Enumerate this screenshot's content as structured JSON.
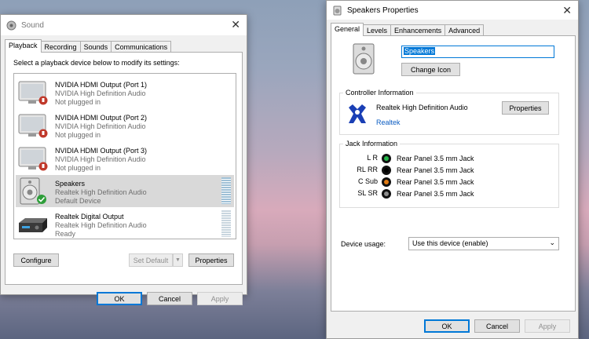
{
  "sound_window": {
    "title": "Sound",
    "tabs": [
      "Playback",
      "Recording",
      "Sounds",
      "Communications"
    ],
    "instruction": "Select a playback device below to modify its settings:",
    "devices": [
      {
        "name": "NVIDIA HDMI Output (Port 1)",
        "driver": "NVIDIA High Definition Audio",
        "status": "Not plugged in"
      },
      {
        "name": "NVIDIA HDMI Output (Port 2)",
        "driver": "NVIDIA High Definition Audio",
        "status": "Not plugged in"
      },
      {
        "name": "NVIDIA HDMI Output (Port 3)",
        "driver": "NVIDIA High Definition Audio",
        "status": "Not plugged in"
      },
      {
        "name": "Speakers",
        "driver": "Realtek High Definition Audio",
        "status": "Default Device"
      },
      {
        "name": "Realtek Digital Output",
        "driver": "Realtek High Definition Audio",
        "status": "Ready"
      }
    ],
    "configure_label": "Configure",
    "set_default_label": "Set Default",
    "properties_label": "Properties",
    "ok_label": "OK",
    "cancel_label": "Cancel",
    "apply_label": "Apply"
  },
  "speakers_window": {
    "title": "Speakers Properties",
    "tabs": [
      "General",
      "Levels",
      "Enhancements",
      "Advanced"
    ],
    "device_name": "Speakers",
    "change_icon_label": "Change Icon",
    "controller_section": "Controller Information",
    "controller_name": "Realtek High Definition Audio",
    "controller_vendor": "Realtek",
    "properties_label": "Properties",
    "jack_section": "Jack Information",
    "jacks": [
      {
        "channel": "L R",
        "color": "#25b84a",
        "desc": "Rear Panel 3.5 mm Jack"
      },
      {
        "channel": "RL RR",
        "color": "#000000",
        "desc": "Rear Panel 3.5 mm Jack"
      },
      {
        "channel": "C Sub",
        "color": "#e07a12",
        "desc": "Rear Panel 3.5 mm Jack"
      },
      {
        "channel": "SL SR",
        "color": "#8d8d8d",
        "desc": "Rear Panel 3.5 mm Jack"
      }
    ],
    "device_usage_label": "Device usage:",
    "device_usage_value": "Use this device (enable)",
    "ok_label": "OK",
    "cancel_label": "Cancel",
    "apply_label": "Apply"
  }
}
